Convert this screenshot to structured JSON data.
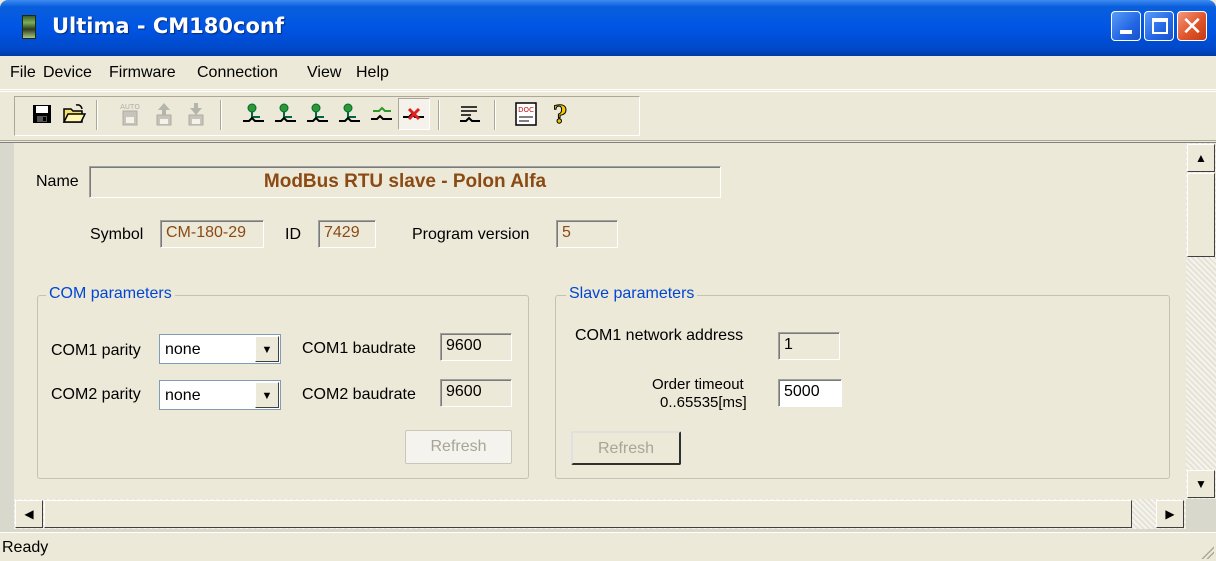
{
  "window": {
    "title": "Ultima - CM180conf",
    "controls": [
      "minimize",
      "maximize",
      "close"
    ]
  },
  "menu": [
    "File",
    "Device",
    "Firmware",
    "Connection",
    "View",
    "Help"
  ],
  "toolbar": {
    "buttons": [
      {
        "icon": "save-icon"
      },
      {
        "icon": "open-icon"
      },
      {
        "icon": "auto-detect-icon",
        "label": "AUTO",
        "disabled": true
      },
      {
        "icon": "upload-icon",
        "disabled": true
      },
      {
        "icon": "download-icon",
        "disabled": true
      },
      {
        "icon": "connect-com1-icon"
      },
      {
        "icon": "connect-com2-icon"
      },
      {
        "icon": "connect-com3-icon"
      },
      {
        "icon": "connect-com4-icon"
      },
      {
        "icon": "connect-net-icon"
      },
      {
        "icon": "disconnect-icon",
        "pressed": true
      },
      {
        "icon": "monitor-icon"
      },
      {
        "icon": "doc-icon",
        "label": "DOC"
      },
      {
        "icon": "help-icon"
      }
    ]
  },
  "device": {
    "name_label": "Name",
    "name": "ModBus RTU slave - Polon Alfa",
    "symbol_label": "Symbol",
    "symbol": "CM-180-29",
    "id_label": "ID",
    "id": "7429",
    "version_label": "Program version",
    "version": "5"
  },
  "com_params": {
    "title": "COM parameters",
    "com1_parity_label": "COM1 parity",
    "com1_parity": "none",
    "com2_parity_label": "COM2 parity",
    "com2_parity": "none",
    "com1_baud_label": "COM1 baudrate",
    "com1_baud": "9600",
    "com2_baud_label": "COM2 baudrate",
    "com2_baud": "9600",
    "refresh": "Refresh"
  },
  "slave_params": {
    "title": "Slave parameters",
    "address_label": "COM1 network address",
    "address": "1",
    "timeout_label_1": "Order timeout",
    "timeout_label_2": "0..65535[ms]",
    "timeout": "5000",
    "refresh": "Refresh"
  },
  "status": "Ready",
  "colors": {
    "titlebar": "#0055e5",
    "value_text": "#8b4a14",
    "group_title": "#0046d5",
    "face": "#ece9d8"
  }
}
